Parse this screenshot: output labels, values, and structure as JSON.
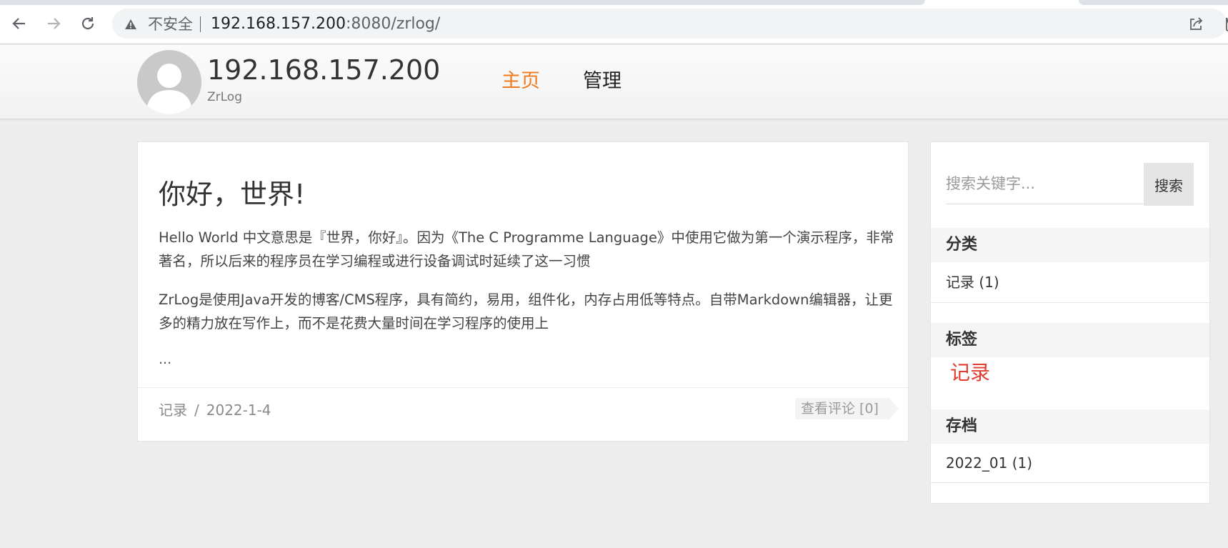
{
  "browser": {
    "insecure_label": "不安全",
    "url_host": "192.168.157.200",
    "url_rest": ":8080/zrlog/",
    "icons": [
      "back-icon",
      "forward-icon",
      "reload-icon",
      "warning-icon",
      "share-icon",
      "star-icon"
    ]
  },
  "site": {
    "title": "192.168.157.200",
    "subtitle": "ZrLog",
    "nav": {
      "home_label": "主页",
      "admin_label": "管理"
    },
    "accent_color": "#f07b1f"
  },
  "post": {
    "title": "你好，世界!",
    "paragraphs": [
      "Hello World 中文意思是『世界，你好』。因为《The C Programme Language》中使用它做为第一个演示程序，非常著名，所以后来的程序员在学习编程或进行设备调试时延续了这一习惯",
      "ZrLog是使用Java开发的博客/CMS程序，具有简约，易用，组件化，内存占用低等特点。自带Markdown编辑器，让更多的精力放在写作上，而不是花费大量时间在学习程序的使用上"
    ],
    "more": "...",
    "category": "记录",
    "meta_separator": "/",
    "date": "2022-1-4",
    "comments_label": "查看评论 [0]"
  },
  "sidebar": {
    "search": {
      "placeholder": "搜索关键字...",
      "button_label": "搜索"
    },
    "categories": {
      "heading": "分类",
      "items": [
        {
          "label": "记录 (1)"
        }
      ]
    },
    "tags": {
      "heading": "标签",
      "items": [
        {
          "label": "记录"
        }
      ],
      "tag_color": "#e33b2d"
    },
    "archives": {
      "heading": "存档",
      "items": [
        {
          "label": "2022_01 (1)"
        }
      ]
    }
  }
}
